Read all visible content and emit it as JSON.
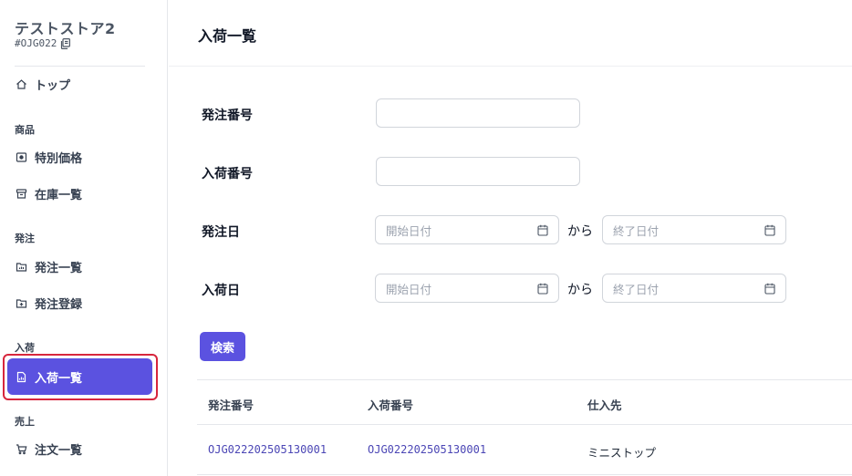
{
  "store": {
    "name": "テストストア2",
    "code": "#OJG022"
  },
  "sidebar": {
    "top_label": "トップ",
    "sections": {
      "products": "商品",
      "orders": "発注",
      "arrivals": "入荷",
      "sales": "売上"
    },
    "items": {
      "special_price": "特別価格",
      "inventory_list": "在庫一覧",
      "order_list": "発注一覧",
      "order_register": "発注登録",
      "arrival_list": "入荷一覧",
      "sales_order_list": "注文一覧"
    },
    "active_item": "入荷一覧"
  },
  "page": {
    "title": "入荷一覧"
  },
  "form": {
    "order_number_label": "発注番号",
    "order_number_value": "",
    "arrival_number_label": "入荷番号",
    "arrival_number_value": "",
    "order_date_label": "発注日",
    "arrival_date_label": "入荷日",
    "start_date_placeholder": "開始日付",
    "end_date_placeholder": "終了日付",
    "range_separator": "から",
    "search_button": "検索"
  },
  "table": {
    "columns": [
      "発注番号",
      "入荷番号",
      "仕入先"
    ],
    "rows": [
      {
        "order_number": "OJG022202505130001",
        "arrival_number": "OJG022202505130001",
        "supplier": "ミニストップ"
      }
    ]
  },
  "colors": {
    "accent": "#5b52e0",
    "highlight": "#d7263d",
    "link": "#4b46b5"
  }
}
